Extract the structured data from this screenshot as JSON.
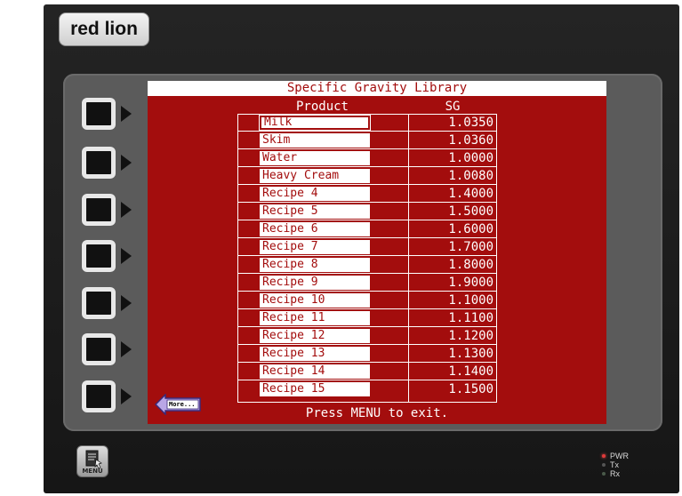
{
  "brand": {
    "logo_text": "red lion"
  },
  "screen": {
    "title": "Specific Gravity Library",
    "col_product": "Product",
    "col_sg": "SG",
    "rows": [
      {
        "name": "Milk",
        "sg": "1.0350"
      },
      {
        "name": "Skim",
        "sg": "1.0360"
      },
      {
        "name": "Water",
        "sg": "1.0000"
      },
      {
        "name": "Heavy Cream",
        "sg": "1.0080"
      },
      {
        "name": "Recipe 4",
        "sg": "1.4000"
      },
      {
        "name": "Recipe 5",
        "sg": "1.5000"
      },
      {
        "name": "Recipe 6",
        "sg": "1.6000"
      },
      {
        "name": "Recipe 7",
        "sg": "1.7000"
      },
      {
        "name": "Recipe 8",
        "sg": "1.8000"
      },
      {
        "name": "Recipe 9",
        "sg": "1.9000"
      },
      {
        "name": "Recipe 10",
        "sg": "1.1000"
      },
      {
        "name": "Recipe 11",
        "sg": "1.1100"
      },
      {
        "name": "Recipe 12",
        "sg": "1.1200"
      },
      {
        "name": "Recipe 13",
        "sg": "1.1300"
      },
      {
        "name": "Recipe 14",
        "sg": "1.1400"
      },
      {
        "name": "Recipe 15",
        "sg": "1.1500"
      }
    ],
    "more_label": "More...",
    "footer": "Press MENU to exit."
  },
  "menu_button": {
    "label": "MENU",
    "icon": "menu-document-icon"
  },
  "indicators": [
    {
      "label": "PWR",
      "color": "#e03a3a"
    },
    {
      "label": "Tx",
      "color": "#555555"
    },
    {
      "label": "Rx",
      "color": "#4a5a4a"
    }
  ],
  "colors": {
    "screen_bg": "#a30d0d",
    "screen_fg": "#ffffff"
  }
}
